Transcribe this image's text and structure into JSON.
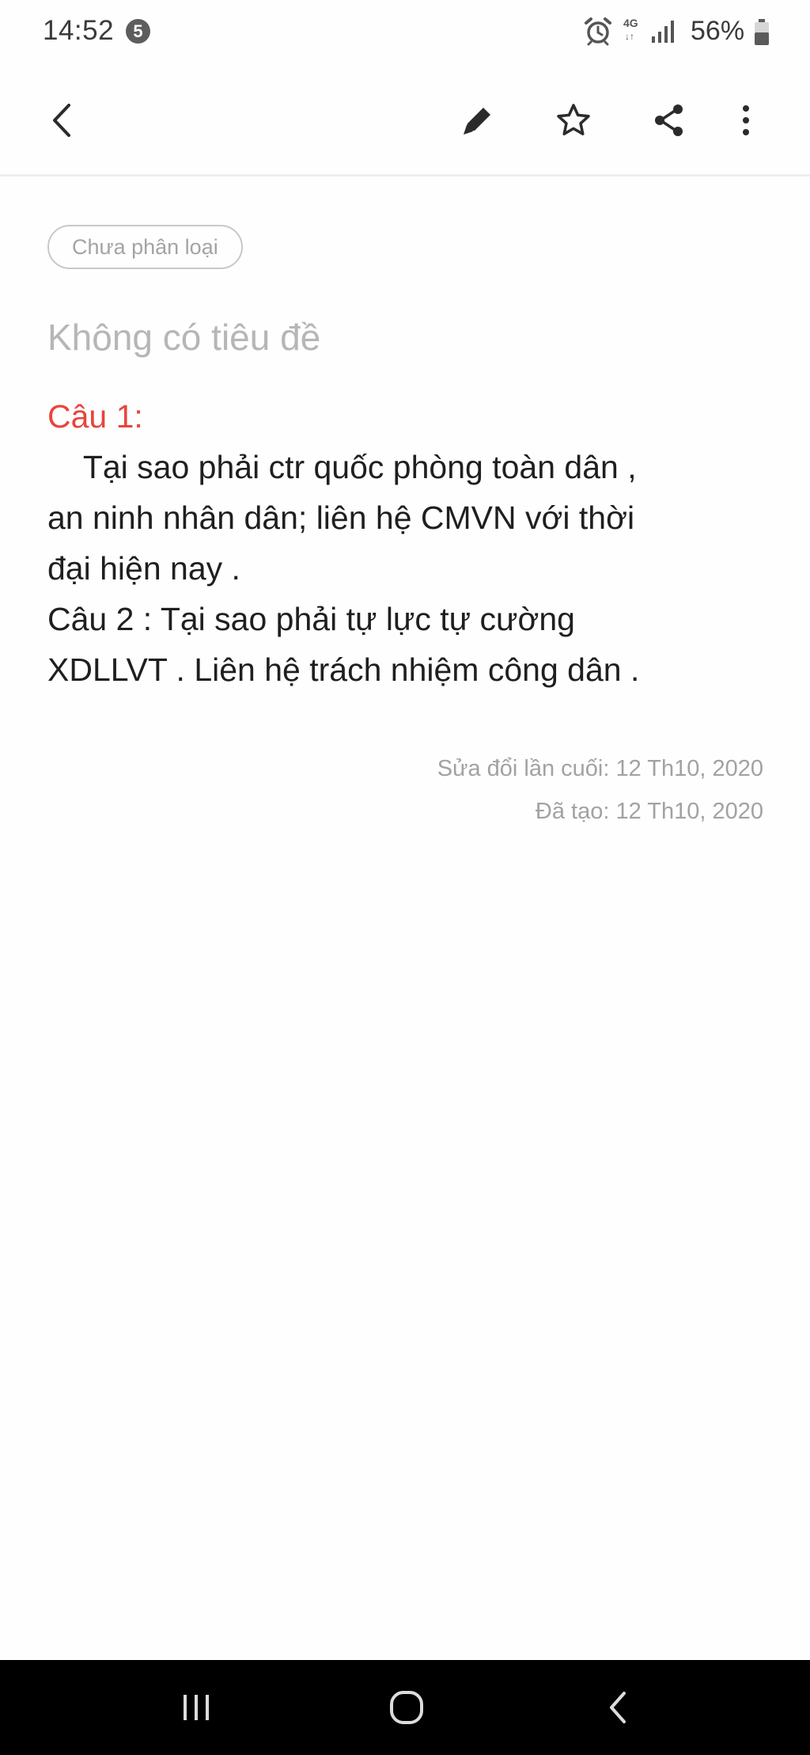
{
  "status_bar": {
    "time": "14:52",
    "notification_count": "5",
    "network_type": "4G",
    "network_arrows": "↓↑",
    "battery_percent": "56%",
    "icons": [
      "alarm-icon",
      "signal-icon",
      "battery-icon"
    ]
  },
  "toolbar": {
    "icons": [
      "back-icon",
      "edit-icon",
      "star-icon",
      "share-icon",
      "more-icon"
    ]
  },
  "note": {
    "category": "Chưa phân loại",
    "title_placeholder": "Không có tiêu đề",
    "body": {
      "q1_heading": "Câu 1:",
      "q1_lines": [
        "    Tại sao phải ctr quốc phòng toàn dân ,",
        "an ninh nhân dân; liên hệ CMVN với thời",
        "đại hiện nay ."
      ],
      "q2_lines": [
        "Câu 2 : Tại sao phải tự lực tự cường",
        "XDLLVT . Liên hệ trách nhiệm công dân ."
      ]
    },
    "last_modified": "Sửa đổi lần cuối: 12 Th10, 2020",
    "created": "Đã tạo: 12 Th10, 2020"
  },
  "nav_bar": {
    "icons": [
      "recent-apps-icon",
      "home-icon",
      "nav-back-icon"
    ]
  },
  "colors": {
    "accent_red": "#e8453c",
    "body_text": "#1f1f1f",
    "muted_text": "#a2a2a2",
    "background": "#fefefe",
    "nav_bar": "#000000"
  }
}
